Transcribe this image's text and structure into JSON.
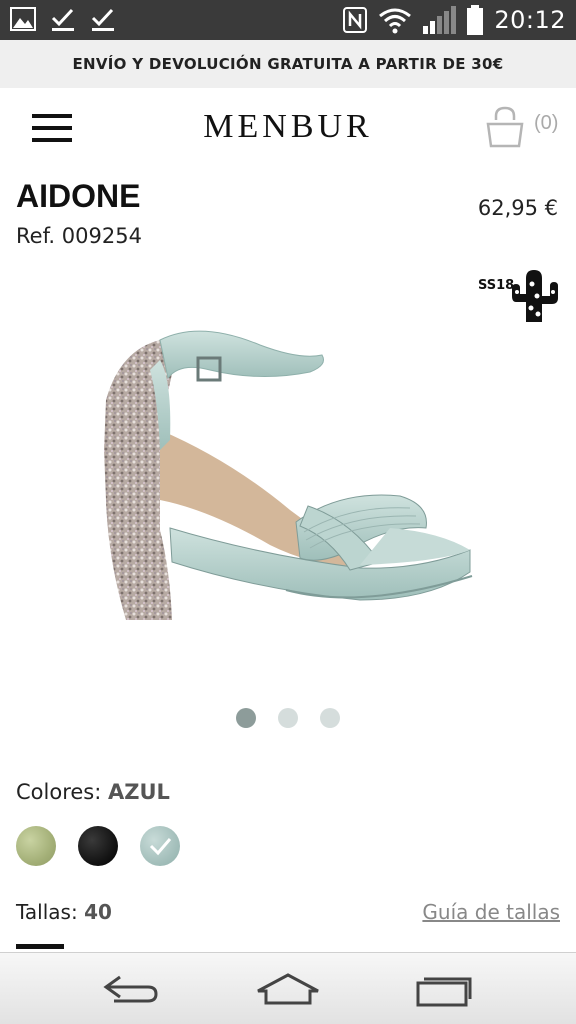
{
  "status_bar": {
    "time": "20:12",
    "icons": [
      "gallery-icon",
      "download-check-icon",
      "download-check-icon",
      "nfc-icon",
      "wifi-icon",
      "signal-icon",
      "battery-icon"
    ]
  },
  "promo": {
    "text": "ENVÍO Y DEVOLUCIÓN GRATUITA A PARTIR DE 30€"
  },
  "header": {
    "logo": "MENBUR",
    "cart_count": "(0)"
  },
  "product": {
    "name": "AIDONE",
    "ref": "Ref. 009254",
    "price": "62,95 €",
    "season_badge": "SS18",
    "gallery": {
      "image_count": 3,
      "active_index": 0
    }
  },
  "colors": {
    "label": "Colores:",
    "selected": "AZUL",
    "options": [
      {
        "name": "green",
        "color": "#a4b078"
      },
      {
        "name": "black",
        "color": "#151515"
      },
      {
        "name": "blue",
        "color": "#a5c0bc",
        "selected": true
      }
    ]
  },
  "sizes": {
    "label": "Tallas:",
    "selected": "40",
    "guide_link": "Guía de tallas"
  },
  "nav_bar": {
    "icons": [
      "back-icon",
      "home-icon",
      "recent-apps-icon"
    ]
  }
}
